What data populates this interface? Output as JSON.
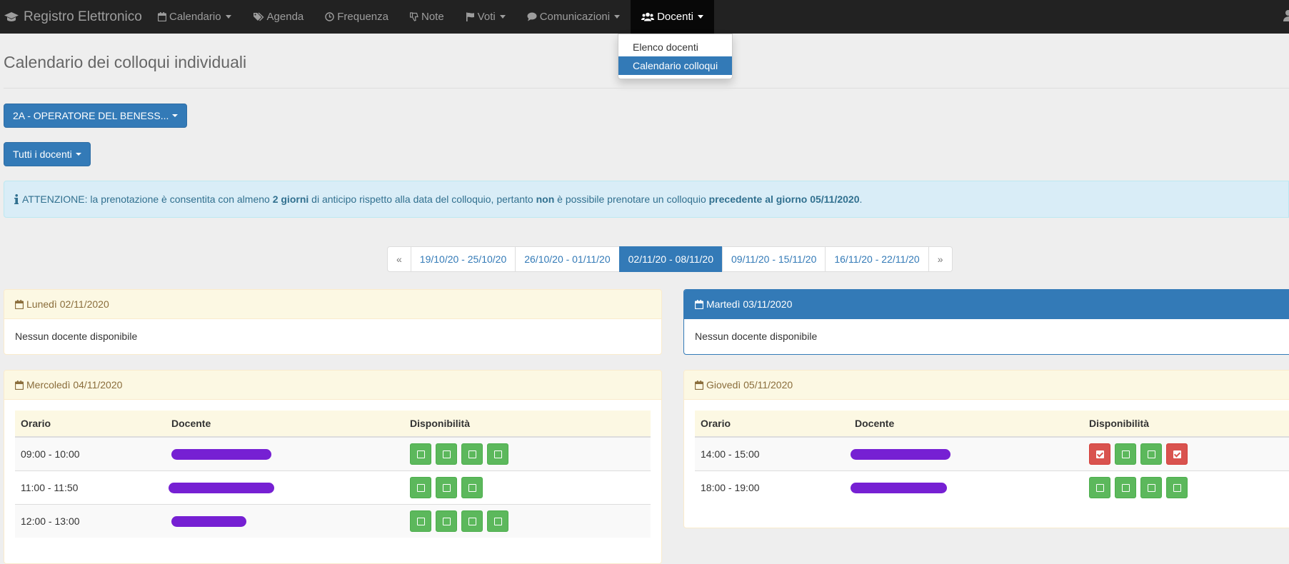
{
  "navbar": {
    "brand": "Registro Elettronico",
    "items": [
      {
        "label": "Calendario",
        "icon": "calendar-icon",
        "dropdown": true
      },
      {
        "label": "Agenda",
        "icon": "tags-icon",
        "dropdown": false
      },
      {
        "label": "Frequenza",
        "icon": "clock-icon",
        "dropdown": false
      },
      {
        "label": "Note",
        "icon": "thumbs-down-icon",
        "dropdown": false
      },
      {
        "label": "Voti",
        "icon": "flag-icon",
        "dropdown": true
      },
      {
        "label": "Comunicazioni",
        "icon": "comment-icon",
        "dropdown": true
      },
      {
        "label": "Docenti",
        "icon": "users-icon",
        "dropdown": true,
        "active": true
      }
    ],
    "docenti_menu": [
      "Elenco docenti",
      "Calendario colloqui"
    ],
    "docenti_menu_active": "Calendario colloqui"
  },
  "page": {
    "title": "Calendario dei colloqui individuali",
    "class_select": "2A - OPERATORE DEL BENESS...",
    "teacher_select": "Tutti i docenti"
  },
  "alert": {
    "t1": "ATTENZIONE: la prenotazione è consentita con almeno ",
    "b1": "2 giorni",
    "t2": " di anticipo rispetto alla data del colloquio, pertanto ",
    "b2": "non",
    "t3": " è possibile prenotare un colloquio ",
    "b3": "precedente al giorno 05/11/2020",
    "t4": "."
  },
  "pagination": {
    "prev": "«",
    "next": "»",
    "weeks": [
      "19/10/20 - 25/10/20",
      "26/10/20 - 01/11/20",
      "02/11/20 - 08/11/20",
      "09/11/20 - 15/11/20",
      "16/11/20 - 22/11/20"
    ],
    "active": "02/11/20 - 08/11/20"
  },
  "days": {
    "lunedi": {
      "heading": "Lunedì 02/11/2020",
      "empty": "Nessun docente disponibile"
    },
    "martedi": {
      "heading": "Martedì 03/11/2020",
      "empty": "Nessun docente disponibile"
    },
    "mercoledi": {
      "heading": "Mercoledì 04/11/2020",
      "columns": [
        "Orario",
        "Docente",
        "Disponibilità"
      ],
      "rows": [
        {
          "orario": "09:00 - 10:00",
          "slots": [
            "free",
            "free",
            "free",
            "free"
          ]
        },
        {
          "orario": "11:00 - 11:50",
          "slots": [
            "free",
            "free",
            "free"
          ]
        },
        {
          "orario": "12:00 - 13:00",
          "slots": [
            "free",
            "free",
            "free",
            "free"
          ]
        }
      ]
    },
    "giovedi": {
      "heading": "Giovedì 05/11/2020",
      "columns": [
        "Orario",
        "Docente",
        "Disponibilità"
      ],
      "rows": [
        {
          "orario": "14:00 - 15:00",
          "slots": [
            "booked",
            "free",
            "free",
            "booked"
          ]
        },
        {
          "orario": "18:00 - 19:00",
          "slots": [
            "free",
            "free",
            "free",
            "free"
          ]
        }
      ]
    }
  },
  "colors": {
    "primary": "#337ab7",
    "success": "#5cb85c",
    "danger": "#d9534f",
    "redaction": "#6a0dcf"
  }
}
